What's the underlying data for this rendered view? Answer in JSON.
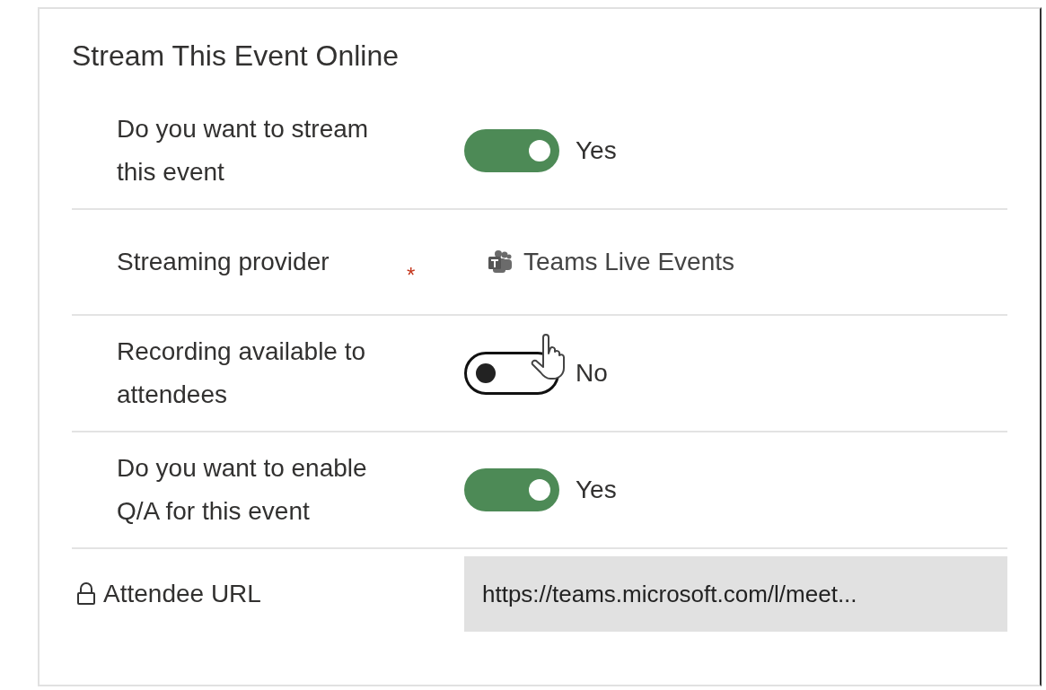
{
  "title": "Stream This Event Online",
  "rows": [
    {
      "kind": "toggle",
      "label": "Do you want to stream this event",
      "on": true,
      "value": "Yes"
    },
    {
      "kind": "lookup",
      "label": "Streaming provider",
      "required_mark": "*",
      "value": "Teams Live Events"
    },
    {
      "kind": "toggle",
      "label": "Recording available to attendees",
      "on": false,
      "value": "No"
    },
    {
      "kind": "toggle",
      "label": "Do you want to enable Q/A for this event",
      "on": true,
      "value": "Yes"
    },
    {
      "kind": "locked",
      "label": "Attendee URL",
      "value": "https://teams.microsoft.com/l/meet..."
    }
  ]
}
